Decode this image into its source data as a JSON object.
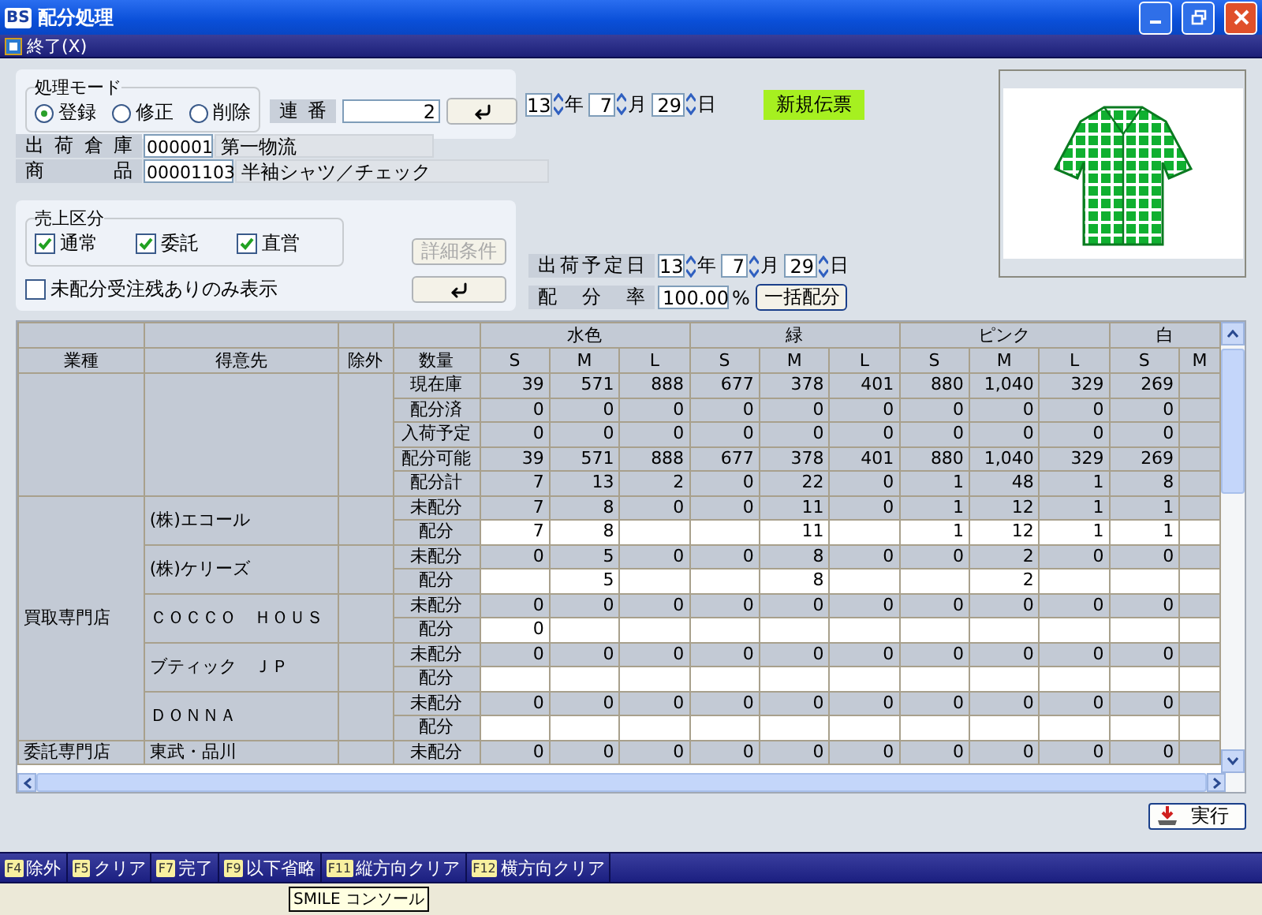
{
  "window": {
    "logo": "BS",
    "title": "配分処理"
  },
  "menu": {
    "label": "終了(X)"
  },
  "mode_group": {
    "title": "処理モード",
    "options": [
      {
        "label": "登録",
        "selected": true
      },
      {
        "label": "修正",
        "selected": false
      },
      {
        "label": "削除",
        "selected": false
      }
    ]
  },
  "serial": {
    "label": "連番",
    "value": "2"
  },
  "slip_date": [
    {
      "value": "13",
      "unit": "年"
    },
    {
      "value": "7",
      "unit": "月"
    },
    {
      "value": "29",
      "unit": "日"
    }
  ],
  "slip_status": "新規伝票",
  "warehouse": {
    "label": "出荷倉庫",
    "code": "000001",
    "name": "第一物流"
  },
  "product": {
    "label": "商品",
    "code": "00001103",
    "name": "半袖シャツ／チェック"
  },
  "sales_group": {
    "title": "売上区分",
    "options": [
      {
        "label": "通常",
        "checked": true
      },
      {
        "label": "委託",
        "checked": true
      },
      {
        "label": "直営",
        "checked": true
      }
    ]
  },
  "unallocated_only": {
    "label": "未配分受注残ありのみ表示",
    "checked": false
  },
  "detail_button": {
    "label": "詳細条件",
    "disabled": true
  },
  "ship_date": {
    "label": "出荷予定日",
    "parts": [
      {
        "value": "13",
        "unit": "年"
      },
      {
        "value": "7",
        "unit": "月"
      },
      {
        "value": "29",
        "unit": "日"
      }
    ]
  },
  "allocation_rate": {
    "label": "配分率",
    "value": "100.00",
    "unit": "%",
    "button": "一括配分"
  },
  "table": {
    "fixed_headers": [
      "業種",
      "得意先",
      "除外",
      "数量"
    ],
    "colors": [
      {
        "name": "水色",
        "sizes": [
          "S",
          "M",
          "L"
        ]
      },
      {
        "name": "緑",
        "sizes": [
          "S",
          "M",
          "L"
        ]
      },
      {
        "name": "ピンク",
        "sizes": [
          "S",
          "M",
          "L"
        ]
      },
      {
        "name": "白",
        "sizes": [
          "S",
          "M"
        ]
      }
    ],
    "summary_rows": [
      {
        "label": "現在庫",
        "values": [
          "39",
          "571",
          "888",
          "677",
          "378",
          "401",
          "880",
          "1,040",
          "329",
          "269"
        ]
      },
      {
        "label": "配分済",
        "values": [
          "0",
          "0",
          "0",
          "0",
          "0",
          "0",
          "0",
          "0",
          "0",
          "0"
        ]
      },
      {
        "label": "入荷予定",
        "values": [
          "0",
          "0",
          "0",
          "0",
          "0",
          "0",
          "0",
          "0",
          "0",
          "0"
        ]
      },
      {
        "label": "配分可能",
        "values": [
          "39",
          "571",
          "888",
          "677",
          "378",
          "401",
          "880",
          "1,040",
          "329",
          "269"
        ]
      },
      {
        "label": "配分計",
        "values": [
          "7",
          "13",
          "2",
          "0",
          "22",
          "0",
          "1",
          "48",
          "1",
          "8"
        ]
      }
    ],
    "groups": [
      {
        "category": "買取専門店",
        "customers": [
          {
            "name": "(株)エコール",
            "rows": [
              {
                "label": "未配分",
                "kind": "remaining",
                "values": [
                  "7",
                  "8",
                  "0",
                  "0",
                  "11",
                  "0",
                  "1",
                  "12",
                  "1",
                  "1"
                ]
              },
              {
                "label": "配分",
                "kind": "allocation",
                "values": {
                  "0": "7",
                  "1": "8",
                  "4": "11",
                  "6": "1",
                  "7": "12",
                  "8": "1",
                  "9": "1"
                }
              }
            ]
          },
          {
            "name": "(株)ケリーズ",
            "rows": [
              {
                "label": "未配分",
                "kind": "remaining",
                "values": [
                  "0",
                  "5",
                  "0",
                  "0",
                  "8",
                  "0",
                  "0",
                  "2",
                  "0",
                  "0"
                ]
              },
              {
                "label": "配分",
                "kind": "allocation",
                "values": {
                  "1": "5",
                  "4": "8",
                  "7": "2"
                }
              }
            ]
          },
          {
            "name": "ＣＯＣＣＯ　ＨＯＵＳ",
            "rows": [
              {
                "label": "未配分",
                "kind": "remaining",
                "values": [
                  "0",
                  "0",
                  "0",
                  "0",
                  "0",
                  "0",
                  "0",
                  "0",
                  "0",
                  "0"
                ]
              },
              {
                "label": "配分",
                "kind": "allocation",
                "values": {
                  "0": "0"
                }
              }
            ]
          },
          {
            "name": "ブティック　ＪＰ",
            "rows": [
              {
                "label": "未配分",
                "kind": "remaining",
                "values": [
                  "0",
                  "0",
                  "0",
                  "0",
                  "0",
                  "0",
                  "0",
                  "0",
                  "0",
                  "0"
                ]
              },
              {
                "label": "配分",
                "kind": "allocation"
              }
            ]
          },
          {
            "name": "ＤＯＮＮＡ",
            "rows": [
              {
                "label": "未配分",
                "kind": "remaining",
                "values": [
                  "0",
                  "0",
                  "0",
                  "0",
                  "0",
                  "0",
                  "0",
                  "0",
                  "0",
                  "0"
                ]
              },
              {
                "label": "配分",
                "kind": "allocation"
              }
            ]
          }
        ]
      },
      {
        "category": "委託専門店",
        "customers": [
          {
            "name": "東武・品川",
            "rows": [
              {
                "label": "未配分",
                "kind": "remaining",
                "values": [
                  "0",
                  "0",
                  "0",
                  "0",
                  "0",
                  "0",
                  "0",
                  "0",
                  "0",
                  "0"
                ]
              }
            ]
          }
        ]
      }
    ]
  },
  "run_button": "実行",
  "function_keys": [
    {
      "key": "F4",
      "label": "除外"
    },
    {
      "key": "F5",
      "label": "クリア"
    },
    {
      "key": "F7",
      "label": "完了"
    },
    {
      "key": "F9",
      "label": "以下省略"
    },
    {
      "key": "F11",
      "label": "縦方向クリア"
    },
    {
      "key": "F12",
      "label": "横方向クリア"
    }
  ],
  "tooltip": "SMILE コンソール"
}
